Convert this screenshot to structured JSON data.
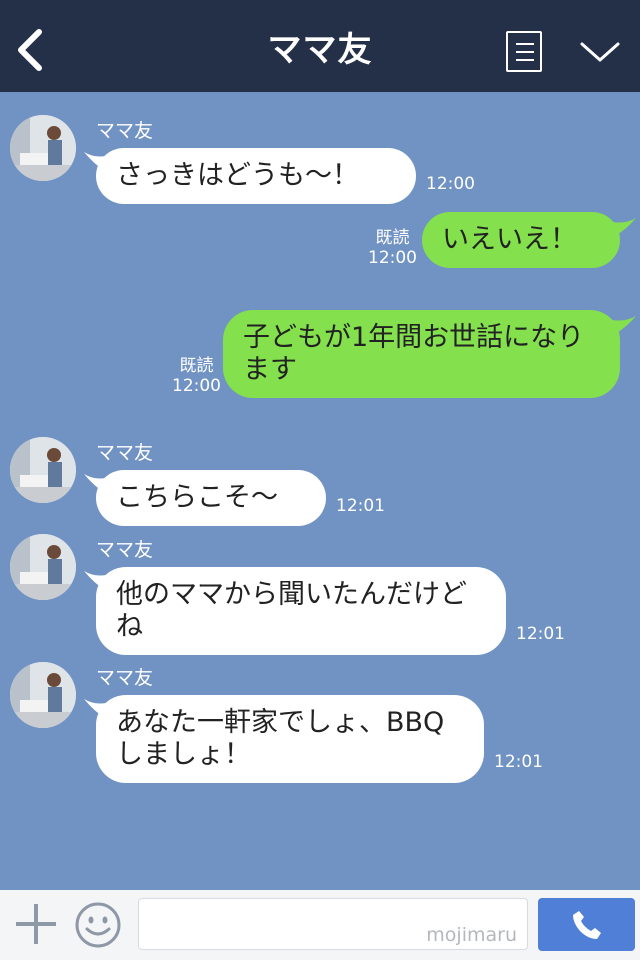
{
  "header": {
    "title": "ママ友",
    "back_icon": "chevron-left-icon",
    "menu_icon": "list-icon",
    "collapse_icon": "chevron-down-icon"
  },
  "messages": [
    {
      "direction": "in",
      "sender": "ママ友",
      "text": "さっきはどうも〜！",
      "time": "12:00"
    },
    {
      "direction": "out",
      "read": "既読",
      "text": "いえいえ！",
      "time": "12:00"
    },
    {
      "direction": "out",
      "read": "既読",
      "text": "子どもが1年間お世話になります",
      "time": "12:00"
    },
    {
      "direction": "in",
      "sender": "ママ友",
      "text": "こちらこそ〜",
      "time": "12:01"
    },
    {
      "direction": "in",
      "sender": "ママ友",
      "text": "他のママから聞いたんだけどね",
      "time": "12:01"
    },
    {
      "direction": "in",
      "sender": "ママ友",
      "text": "あなた一軒家でしょ、BBQしましょ！",
      "time": "12:01"
    }
  ],
  "footer": {
    "plus_icon": "plus-icon",
    "emoji_icon": "smiley-icon",
    "input_value": "",
    "watermark": "mojimaru",
    "call_icon": "phone-icon"
  },
  "colors": {
    "header_bg": "#243048",
    "chat_bg": "#7193c3",
    "outgoing_bubble": "#84e04d",
    "incoming_bubble": "#ffffff",
    "call_button": "#4f7fd6"
  }
}
